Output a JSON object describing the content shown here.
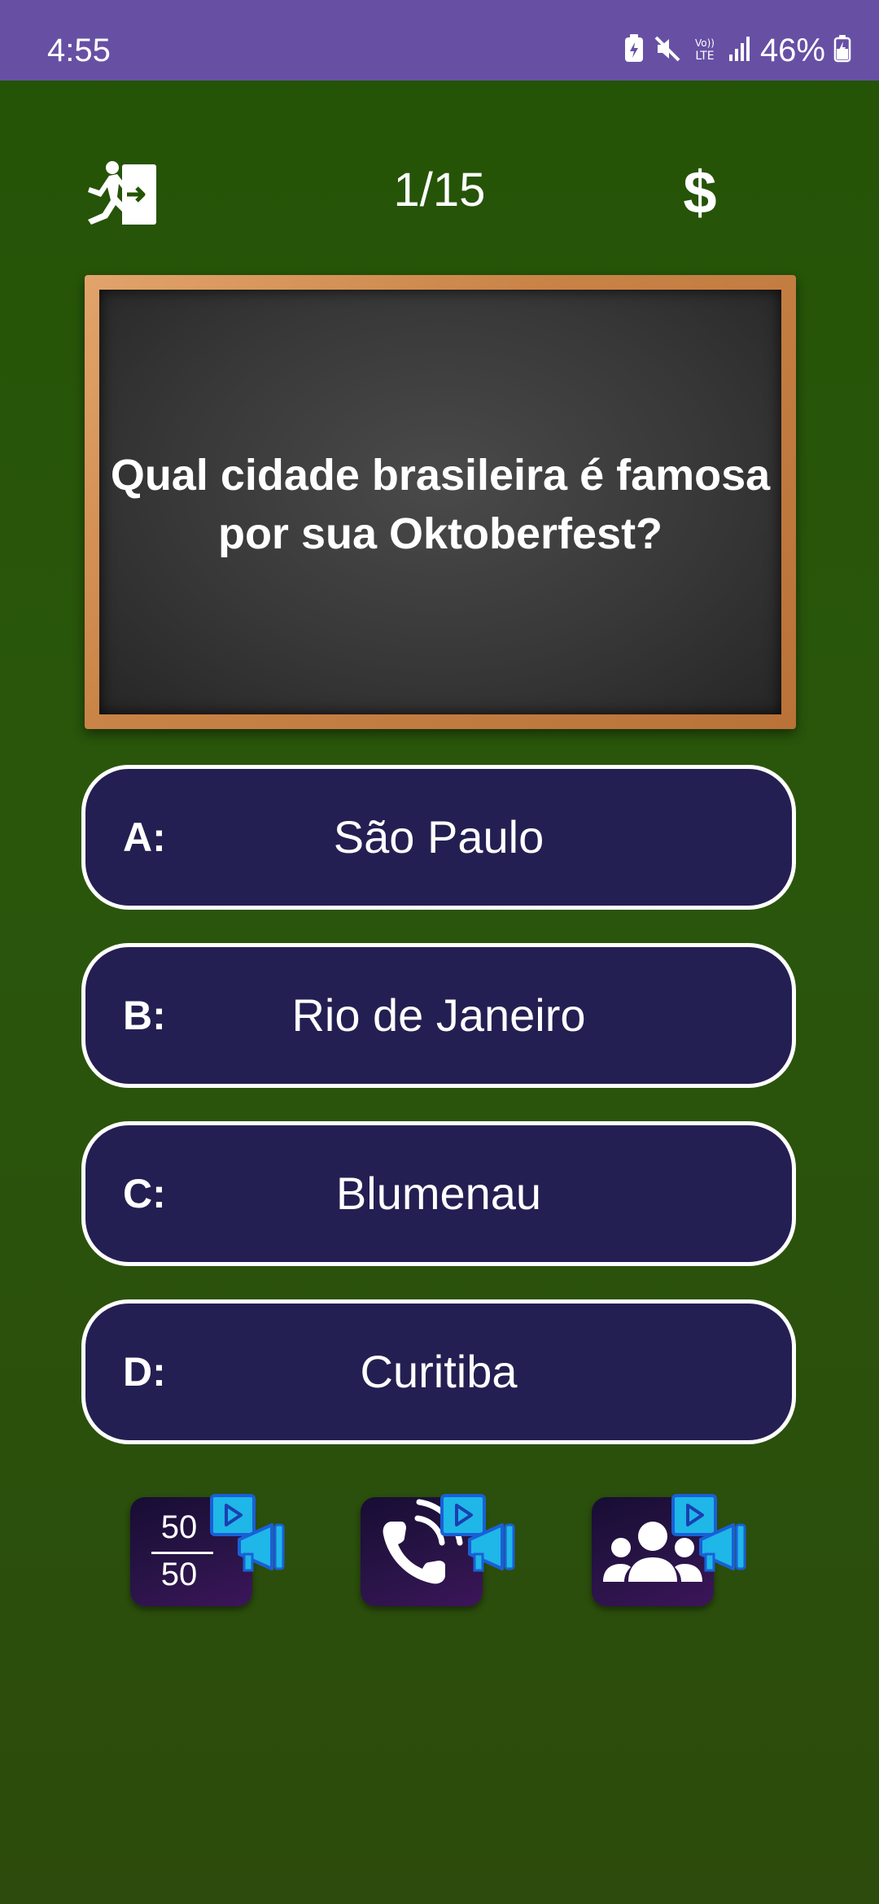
{
  "status_bar": {
    "time": "4:55",
    "battery_percent": "46%",
    "network_label_top": "Vo))",
    "network_label_bottom": "LTE"
  },
  "header": {
    "question_counter": "1/15",
    "money_symbol": "$",
    "exit_icon": "exit-door-icon"
  },
  "question": {
    "text": "Qual cidade brasileira é famosa por sua Oktoberfest?"
  },
  "answers": [
    {
      "letter": "A:",
      "text": "São Paulo"
    },
    {
      "letter": "B:",
      "text": "Rio de Janeiro"
    },
    {
      "letter": "C:",
      "text": "Blumenau"
    },
    {
      "letter": "D:",
      "text": "Curitiba"
    }
  ],
  "lifelines": {
    "fifty_fifty": {
      "top": "50",
      "bottom": "50",
      "icon": "fifty-fifty-icon"
    },
    "phone": {
      "icon": "phone-call-icon"
    },
    "audience": {
      "icon": "audience-icon"
    },
    "ad_badge_icon": "video-ad-megaphone-icon"
  },
  "colors": {
    "status_bar": "#6750a4",
    "background": "#245406",
    "answer_fill": "#241f52",
    "answer_border": "#ffffff",
    "board_frame": "#c98346",
    "board_surface": "#3a3a3a",
    "ad_badge": "#1fb6e8"
  }
}
